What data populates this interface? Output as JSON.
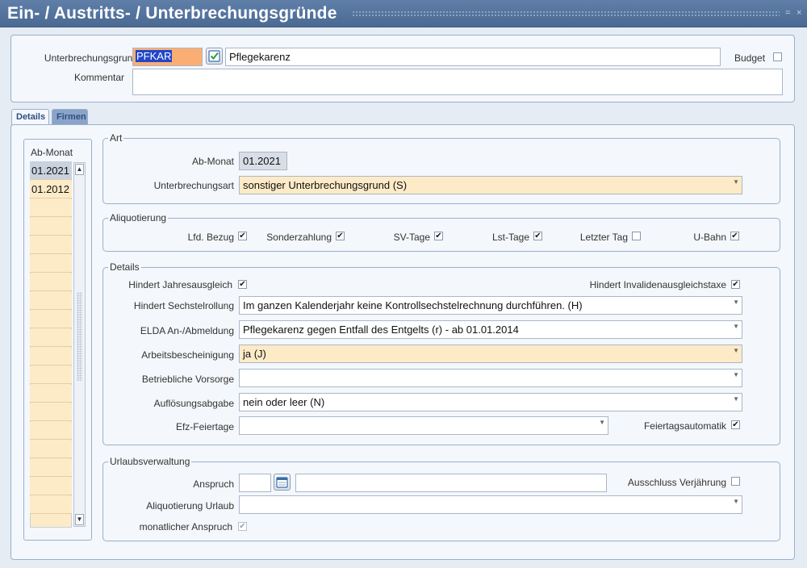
{
  "window": {
    "title": "Ein- / Austritts- / Unterbrechungsgründe",
    "btn_restore": "=",
    "btn_close": "×"
  },
  "header": {
    "grund_label": "Unterbrechungsgrund",
    "grund_code": "PFKAR",
    "grund_name": "Pflegekarenz",
    "budget_label": "Budget",
    "budget_checked": false,
    "kommentar_label": "Kommentar",
    "kommentar_value": ""
  },
  "tabs": [
    {
      "label": "Details",
      "active": true
    },
    {
      "label": "Firmen",
      "active": false
    }
  ],
  "months_list": {
    "header": "Ab-Monat",
    "items": [
      "01.2021",
      "01.2012"
    ]
  },
  "art": {
    "title": "Art",
    "abmonat_label": "Ab-Monat",
    "abmonat_value": "01.2021",
    "unterbrechungsart_label": "Unterbrechungsart",
    "unterbrechungsart_value": "sonstiger Unterbrechungsgrund (S)"
  },
  "aliquotierung": {
    "title": "Aliquotierung",
    "items": [
      {
        "label": "Lfd. Bezug",
        "checked": true
      },
      {
        "label": "Sonderzahlung",
        "checked": true
      },
      {
        "label": "SV-Tage",
        "checked": true
      },
      {
        "label": "Lst-Tage",
        "checked": true
      },
      {
        "label": "Letzter Tag",
        "checked": false
      },
      {
        "label": "U-Bahn",
        "checked": true
      }
    ]
  },
  "details": {
    "title": "Details",
    "jahresausgleich_label": "Hindert Jahresausgleich",
    "invalidenausgleichstaxe_label": "Hindert Invalidenausgleichstaxe",
    "sechstelrollung_label": "Hindert Sechstelrollung",
    "sechstelrollung_value": "Im ganzen Kalenderjahr keine Kontrollsechstelrechnung durchführen. (H)",
    "elda_label": "ELDA An-/Abmeldung",
    "elda_value": "Pflegekarenz gegen Entfall des Entgelts (r) - ab 01.01.2014",
    "arbeitsbescheinigung_label": "Arbeitsbescheinigung",
    "arbeitsbescheinigung_value": "ja (J)",
    "vorsorge_label": "Betriebliche Vorsorge",
    "vorsorge_value": "",
    "aufloesungsabgabe_label": "Auflösungsabgabe",
    "aufloesungsabgabe_value": "nein oder leer (N)",
    "efz_label": "Efz-Feiertage",
    "efz_value": "",
    "feiertagsautomatik_label": "Feiertagsautomatik"
  },
  "urlaub": {
    "title": "Urlaubsverwaltung",
    "anspruch_label": "Anspruch",
    "anspruch_value": "",
    "anspruch_text": "",
    "verjaehrung_label": "Ausschluss Verjährung",
    "aliquotierung_label": "Aliquotierung Urlaub",
    "aliquotierung_value": "",
    "monatlich_label": "monatlicher Anspruch"
  }
}
